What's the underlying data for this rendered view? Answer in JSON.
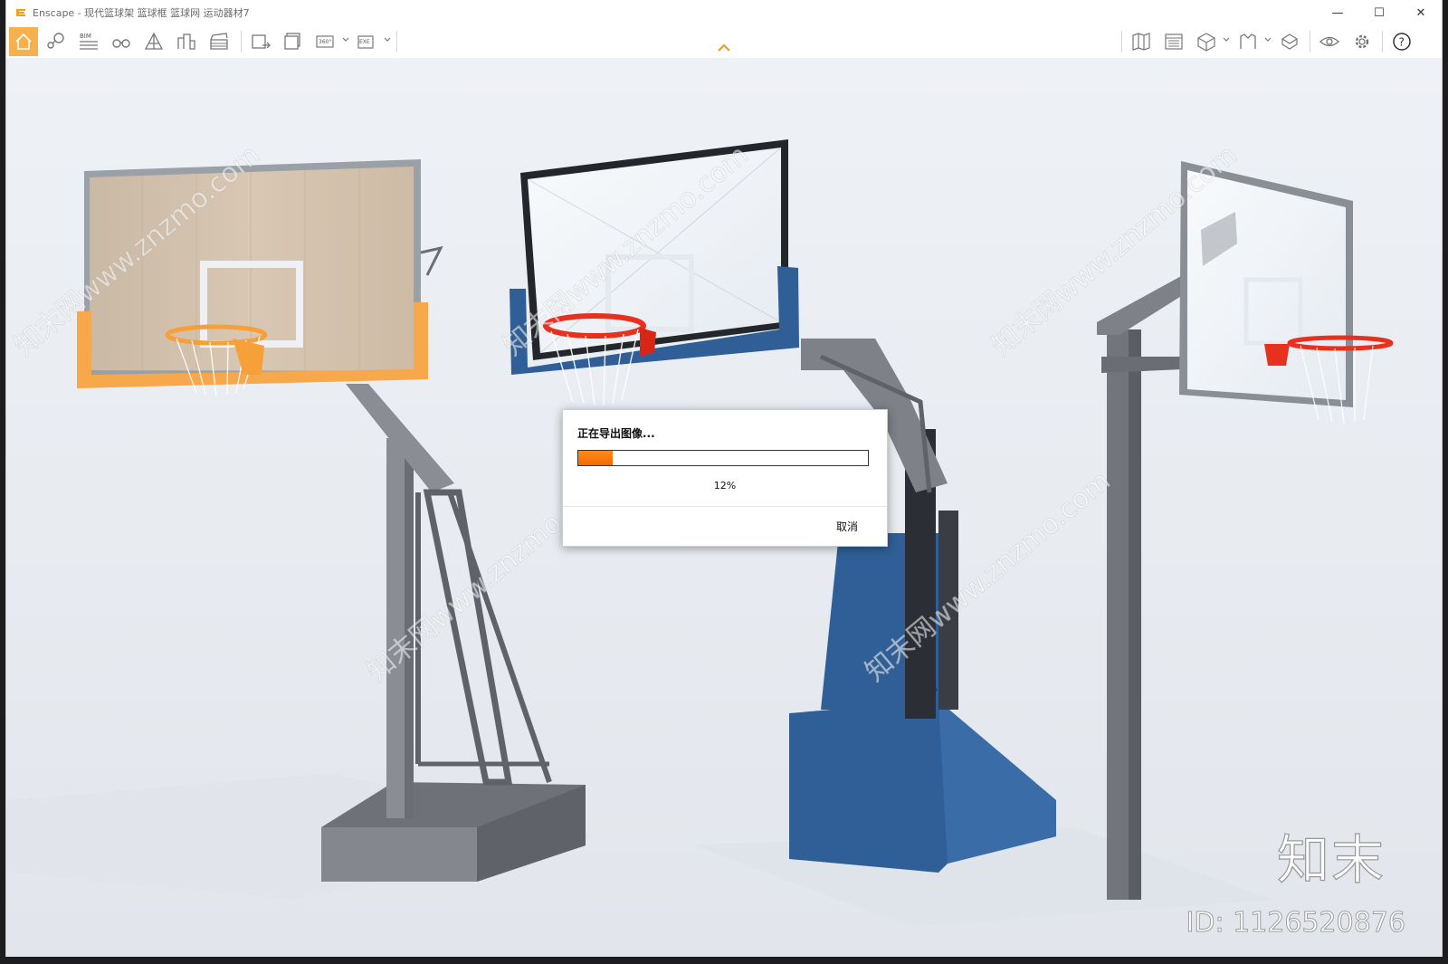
{
  "window": {
    "title": "Enscape - 现代篮球架 篮球框 篮球网 运动器材7",
    "minimize_glyph": "—",
    "maximize_glyph": "☐",
    "close_glyph": "✕"
  },
  "toolbar": {
    "left_icons": [
      "home-icon",
      "map-pin-icon",
      "bim-icon",
      "binoculars-icon",
      "perspective-icon",
      "buildings-icon",
      "clapperboard-icon"
    ],
    "export_icons": [
      "screenshot-export-icon",
      "batch-render-icon",
      "panorama-360-icon",
      "exe-export-icon"
    ],
    "bim_label": "BIM",
    "pano_label": "360°",
    "exe_label": "EXE",
    "right_icons": [
      "map-view-icon",
      "asset-library-icon",
      "cube-view-icon",
      "reflect-map-icon",
      "material-editor-icon",
      "visual-settings-icon",
      "settings-icon",
      "help-icon"
    ],
    "help_glyph": "?"
  },
  "dialog": {
    "title": "正在导出图像...",
    "progress": 0.12,
    "progress_text": "12%",
    "cancel_label": "取消"
  },
  "colors": {
    "accent": "#f6b04d",
    "progress": "#f26a00",
    "blue_stand": "#2f5f96",
    "grey_stand": "#7e8188",
    "orange_rim": "#f7a03a",
    "red_rim": "#e8301f"
  },
  "watermark": {
    "brand": "知末",
    "id_text": "ID: 1126520876",
    "url_text": "知末网www.znzmo.com"
  }
}
